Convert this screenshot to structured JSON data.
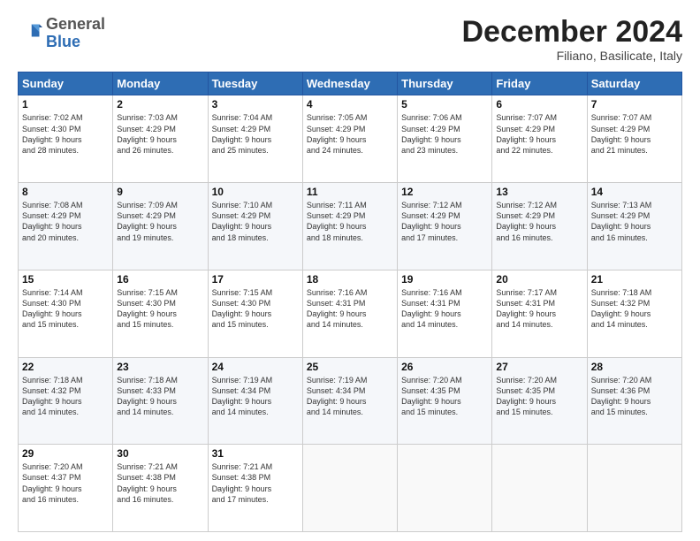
{
  "header": {
    "logo_general": "General",
    "logo_blue": "Blue",
    "month_title": "December 2024",
    "location": "Filiano, Basilicate, Italy"
  },
  "days_of_week": [
    "Sunday",
    "Monday",
    "Tuesday",
    "Wednesday",
    "Thursday",
    "Friday",
    "Saturday"
  ],
  "weeks": [
    [
      {
        "day": "1",
        "info": "Sunrise: 7:02 AM\nSunset: 4:30 PM\nDaylight: 9 hours\nand 28 minutes."
      },
      {
        "day": "2",
        "info": "Sunrise: 7:03 AM\nSunset: 4:29 PM\nDaylight: 9 hours\nand 26 minutes."
      },
      {
        "day": "3",
        "info": "Sunrise: 7:04 AM\nSunset: 4:29 PM\nDaylight: 9 hours\nand 25 minutes."
      },
      {
        "day": "4",
        "info": "Sunrise: 7:05 AM\nSunset: 4:29 PM\nDaylight: 9 hours\nand 24 minutes."
      },
      {
        "day": "5",
        "info": "Sunrise: 7:06 AM\nSunset: 4:29 PM\nDaylight: 9 hours\nand 23 minutes."
      },
      {
        "day": "6",
        "info": "Sunrise: 7:07 AM\nSunset: 4:29 PM\nDaylight: 9 hours\nand 22 minutes."
      },
      {
        "day": "7",
        "info": "Sunrise: 7:07 AM\nSunset: 4:29 PM\nDaylight: 9 hours\nand 21 minutes."
      }
    ],
    [
      {
        "day": "8",
        "info": "Sunrise: 7:08 AM\nSunset: 4:29 PM\nDaylight: 9 hours\nand 20 minutes."
      },
      {
        "day": "9",
        "info": "Sunrise: 7:09 AM\nSunset: 4:29 PM\nDaylight: 9 hours\nand 19 minutes."
      },
      {
        "day": "10",
        "info": "Sunrise: 7:10 AM\nSunset: 4:29 PM\nDaylight: 9 hours\nand 18 minutes."
      },
      {
        "day": "11",
        "info": "Sunrise: 7:11 AM\nSunset: 4:29 PM\nDaylight: 9 hours\nand 18 minutes."
      },
      {
        "day": "12",
        "info": "Sunrise: 7:12 AM\nSunset: 4:29 PM\nDaylight: 9 hours\nand 17 minutes."
      },
      {
        "day": "13",
        "info": "Sunrise: 7:12 AM\nSunset: 4:29 PM\nDaylight: 9 hours\nand 16 minutes."
      },
      {
        "day": "14",
        "info": "Sunrise: 7:13 AM\nSunset: 4:29 PM\nDaylight: 9 hours\nand 16 minutes."
      }
    ],
    [
      {
        "day": "15",
        "info": "Sunrise: 7:14 AM\nSunset: 4:30 PM\nDaylight: 9 hours\nand 15 minutes."
      },
      {
        "day": "16",
        "info": "Sunrise: 7:15 AM\nSunset: 4:30 PM\nDaylight: 9 hours\nand 15 minutes."
      },
      {
        "day": "17",
        "info": "Sunrise: 7:15 AM\nSunset: 4:30 PM\nDaylight: 9 hours\nand 15 minutes."
      },
      {
        "day": "18",
        "info": "Sunrise: 7:16 AM\nSunset: 4:31 PM\nDaylight: 9 hours\nand 14 minutes."
      },
      {
        "day": "19",
        "info": "Sunrise: 7:16 AM\nSunset: 4:31 PM\nDaylight: 9 hours\nand 14 minutes."
      },
      {
        "day": "20",
        "info": "Sunrise: 7:17 AM\nSunset: 4:31 PM\nDaylight: 9 hours\nand 14 minutes."
      },
      {
        "day": "21",
        "info": "Sunrise: 7:18 AM\nSunset: 4:32 PM\nDaylight: 9 hours\nand 14 minutes."
      }
    ],
    [
      {
        "day": "22",
        "info": "Sunrise: 7:18 AM\nSunset: 4:32 PM\nDaylight: 9 hours\nand 14 minutes."
      },
      {
        "day": "23",
        "info": "Sunrise: 7:18 AM\nSunset: 4:33 PM\nDaylight: 9 hours\nand 14 minutes."
      },
      {
        "day": "24",
        "info": "Sunrise: 7:19 AM\nSunset: 4:34 PM\nDaylight: 9 hours\nand 14 minutes."
      },
      {
        "day": "25",
        "info": "Sunrise: 7:19 AM\nSunset: 4:34 PM\nDaylight: 9 hours\nand 14 minutes."
      },
      {
        "day": "26",
        "info": "Sunrise: 7:20 AM\nSunset: 4:35 PM\nDaylight: 9 hours\nand 15 minutes."
      },
      {
        "day": "27",
        "info": "Sunrise: 7:20 AM\nSunset: 4:35 PM\nDaylight: 9 hours\nand 15 minutes."
      },
      {
        "day": "28",
        "info": "Sunrise: 7:20 AM\nSunset: 4:36 PM\nDaylight: 9 hours\nand 15 minutes."
      }
    ],
    [
      {
        "day": "29",
        "info": "Sunrise: 7:20 AM\nSunset: 4:37 PM\nDaylight: 9 hours\nand 16 minutes."
      },
      {
        "day": "30",
        "info": "Sunrise: 7:21 AM\nSunset: 4:38 PM\nDaylight: 9 hours\nand 16 minutes."
      },
      {
        "day": "31",
        "info": "Sunrise: 7:21 AM\nSunset: 4:38 PM\nDaylight: 9 hours\nand 17 minutes."
      },
      {
        "day": "",
        "info": ""
      },
      {
        "day": "",
        "info": ""
      },
      {
        "day": "",
        "info": ""
      },
      {
        "day": "",
        "info": ""
      }
    ]
  ]
}
